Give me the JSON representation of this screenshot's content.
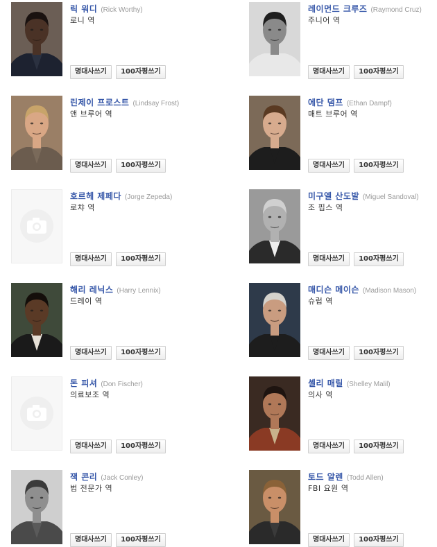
{
  "buttons": {
    "quote": "명대사쓰기",
    "review": "100자평쓰기"
  },
  "cast": [
    {
      "kname": "릭 워디",
      "ename": "(Rick Worthy)",
      "role": "로니 역",
      "photo": true
    },
    {
      "kname": "레이먼드 크루즈",
      "ename": "(Raymond Cruz)",
      "role": "주니어 역",
      "photo": true
    },
    {
      "kname": "린제이 프로스트",
      "ename": "(Lindsay Frost)",
      "role": "앤 브루어 역",
      "photo": true
    },
    {
      "kname": "에단 댐프",
      "ename": "(Ethan Dampf)",
      "role": "매트 브루어 역",
      "photo": true
    },
    {
      "kname": "호르헤 제페다",
      "ename": "(Jorge Zepeda)",
      "role": "로챠 역",
      "photo": false
    },
    {
      "kname": "미구엘 산도발",
      "ename": "(Miguel Sandoval)",
      "role": "조 핍스 역",
      "photo": true
    },
    {
      "kname": "해리 레닉스",
      "ename": "(Harry Lennix)",
      "role": "드레이 역",
      "photo": true
    },
    {
      "kname": "매디슨 메이슨",
      "ename": "(Madison Mason)",
      "role": "슈럽 역",
      "photo": true
    },
    {
      "kname": "돈 피셔",
      "ename": "(Don Fischer)",
      "role": "의료보조 역",
      "photo": false
    },
    {
      "kname": "셸리 매릴",
      "ename": "(Shelley Malil)",
      "role": "의사 역",
      "photo": true
    },
    {
      "kname": "잭 콘리",
      "ename": "(Jack Conley)",
      "role": "법 전문가 역",
      "photo": true
    },
    {
      "kname": "토드 알렌",
      "ename": "(Todd Allen)",
      "role": "FBI 요원 역",
      "photo": true
    }
  ]
}
